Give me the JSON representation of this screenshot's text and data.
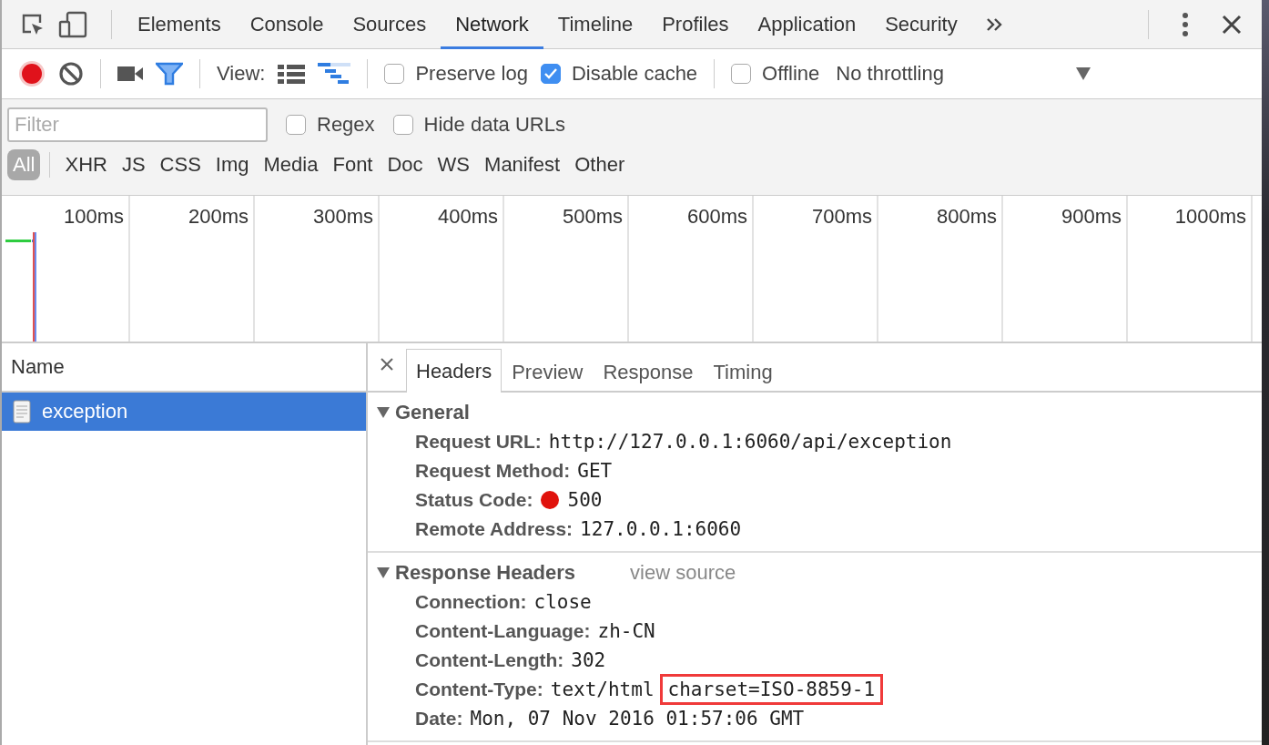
{
  "panel_tabs": [
    {
      "label": "Elements",
      "selected": false
    },
    {
      "label": "Console",
      "selected": false
    },
    {
      "label": "Sources",
      "selected": false
    },
    {
      "label": "Network",
      "selected": true
    },
    {
      "label": "Timeline",
      "selected": false
    },
    {
      "label": "Profiles",
      "selected": false
    },
    {
      "label": "Application",
      "selected": false
    },
    {
      "label": "Security",
      "selected": false
    }
  ],
  "toolbar": {
    "recording": true,
    "filter_on": true,
    "view_label": "View:",
    "large_rows": false,
    "show_overview": true,
    "preserve_log": {
      "label": "Preserve log",
      "checked": false
    },
    "disable_cache": {
      "label": "Disable cache",
      "checked": true
    },
    "offline": {
      "label": "Offline",
      "checked": false
    },
    "throttling": "No throttling"
  },
  "filter": {
    "placeholder": "Filter",
    "regex": {
      "label": "Regex",
      "checked": false
    },
    "hide_data_urls": {
      "label": "Hide data URLs",
      "checked": false
    }
  },
  "resource_types": [
    {
      "label": "All",
      "selected": true
    },
    {
      "label": "XHR",
      "selected": false
    },
    {
      "label": "JS",
      "selected": false
    },
    {
      "label": "CSS",
      "selected": false
    },
    {
      "label": "Img",
      "selected": false
    },
    {
      "label": "Media",
      "selected": false
    },
    {
      "label": "Font",
      "selected": false
    },
    {
      "label": "Doc",
      "selected": false
    },
    {
      "label": "WS",
      "selected": false
    },
    {
      "label": "Manifest",
      "selected": false
    },
    {
      "label": "Other",
      "selected": false
    }
  ],
  "timeline_ticks": [
    "100ms",
    "200ms",
    "300ms",
    "400ms",
    "500ms",
    "600ms",
    "700ms",
    "800ms",
    "900ms",
    "1000ms"
  ],
  "requests": {
    "column": "Name",
    "rows": [
      {
        "name": "exception",
        "selected": true
      }
    ]
  },
  "detail_tabs": [
    {
      "label": "Headers",
      "selected": true
    },
    {
      "label": "Preview",
      "selected": false
    },
    {
      "label": "Response",
      "selected": false
    },
    {
      "label": "Timing",
      "selected": false
    }
  ],
  "sections": [
    {
      "title": "General",
      "expanded": true,
      "rows": [
        {
          "key": "Request URL:",
          "value": "http://127.0.0.1:6060/api/exception",
          "kind": "text"
        },
        {
          "key": "Request Method:",
          "value": "GET",
          "kind": "text"
        },
        {
          "key": "Status Code:",
          "value": "500",
          "kind": "status",
          "color": "#e0120c"
        },
        {
          "key": "Remote Address:",
          "value": "127.0.0.1:6060",
          "kind": "text"
        }
      ]
    },
    {
      "title": "Response Headers",
      "expanded": true,
      "link": "view source",
      "rows": [
        {
          "key": "Connection:",
          "value": "close",
          "kind": "text"
        },
        {
          "key": "Content-Language:",
          "value": "zh-CN",
          "kind": "text"
        },
        {
          "key": "Content-Length:",
          "value": "302",
          "kind": "text"
        },
        {
          "key": "Content-Type:",
          "value": "text/html",
          "highlight": "charset=ISO-8859-1",
          "kind": "highlighted"
        },
        {
          "key": "Date:",
          "value": "Mon, 07 Nov 2016 01:57:06 GMT",
          "kind": "text"
        }
      ]
    }
  ]
}
